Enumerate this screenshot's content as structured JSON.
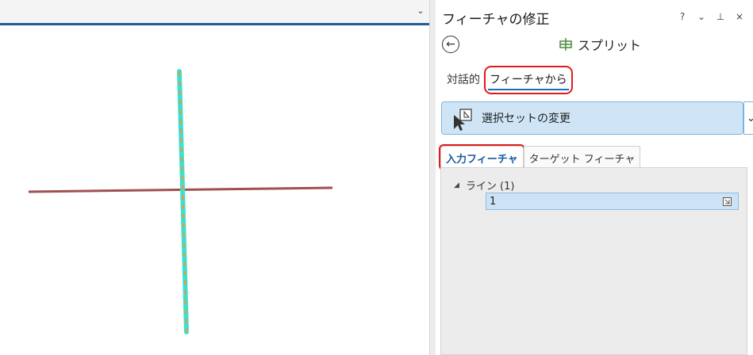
{
  "map": {
    "collapse_glyph": "⌄",
    "colors": {
      "red_line": "#a05050",
      "selected_outline": "#3de0d8",
      "selected_dash": "#e3a02a"
    }
  },
  "pane": {
    "title": "フィーチャの修正",
    "controls": {
      "help": "?",
      "menu": "⌄",
      "pin": "⊥",
      "close": "×"
    },
    "back_glyph": "←",
    "tool_name": "スプリット",
    "tabs": [
      {
        "label": "対話的",
        "active": false
      },
      {
        "label": "フィーチャから",
        "active": true
      }
    ],
    "selection_dropdown": {
      "label": "選択セットの変更",
      "chevron": "⌄"
    },
    "subtabs": [
      {
        "label": "入力フィーチャ",
        "active": true
      },
      {
        "label": "ターゲット フィーチャ",
        "active": false
      }
    ],
    "tree": {
      "expand_glyph": "◢",
      "layer_label": "ライン (1)",
      "items": [
        {
          "label": "1"
        }
      ]
    }
  }
}
